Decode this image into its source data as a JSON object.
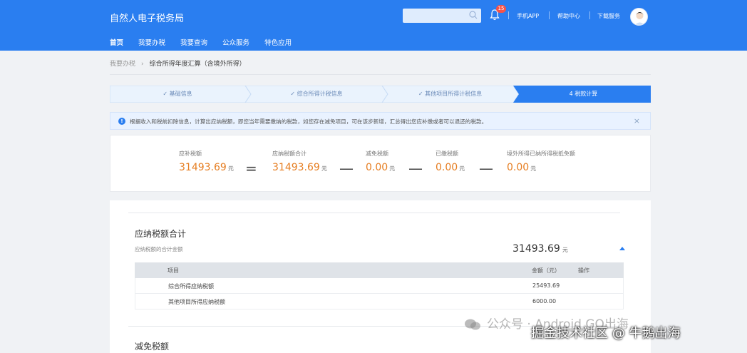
{
  "header": {
    "logo": "自然人电子税务局",
    "notification_count": "15",
    "links": [
      "手机APP",
      "帮助中心",
      "下载服务"
    ],
    "nav": [
      "首页",
      "我要办税",
      "我要查询",
      "公众服务",
      "特色应用"
    ]
  },
  "breadcrumb": {
    "parent": "我要办税",
    "current": "综合所得年度汇算（含境外所得）"
  },
  "steps": [
    {
      "label": "✓ 基础信息"
    },
    {
      "label": "✓ 综合所得计税信息"
    },
    {
      "label": "✓ 其他项目所得计税信息"
    },
    {
      "label": "4  税款计算"
    }
  ],
  "tip": {
    "text": "根据收入和税前扣除信息，计算出应纳税额，即您当年需要缴纳的税款，如您存在减免项目，可在该步新增，汇总得出您应补缴或者可以退还的税款。"
  },
  "summary": {
    "items": [
      {
        "label": "应补税额",
        "value": "31493.69",
        "unit": "元"
      },
      {
        "label": "应纳税额合计",
        "value": "31493.69",
        "unit": "元"
      },
      {
        "label": "减免税额",
        "value": "0.00",
        "unit": "元"
      },
      {
        "label": "已缴税额",
        "value": "0.00",
        "unit": "元"
      },
      {
        "label": "境外所得已纳所得税抵免额",
        "value": "0.00",
        "unit": "元"
      }
    ],
    "ops": [
      "=",
      "—",
      "—",
      "—"
    ]
  },
  "detail": {
    "title": "应纳税额合计",
    "subtitle": "应纳税额的合计金额",
    "total": "31493.69",
    "total_unit": "元",
    "table": {
      "headers": [
        "项目",
        "金额（元）",
        "操作"
      ],
      "rows": [
        [
          "综合所得应纳税额",
          "25493.69",
          ""
        ],
        [
          "其他项目所得应纳税额",
          "6000.00",
          ""
        ]
      ]
    },
    "next_section_title": "减免税额"
  },
  "watermark": {
    "line1": "公众号 · Android GO出海",
    "line2": "掘金技术社区 @ 牛鹅出海"
  },
  "colors": {
    "primary": "#2a7ef0",
    "amount": "#e67e22"
  }
}
